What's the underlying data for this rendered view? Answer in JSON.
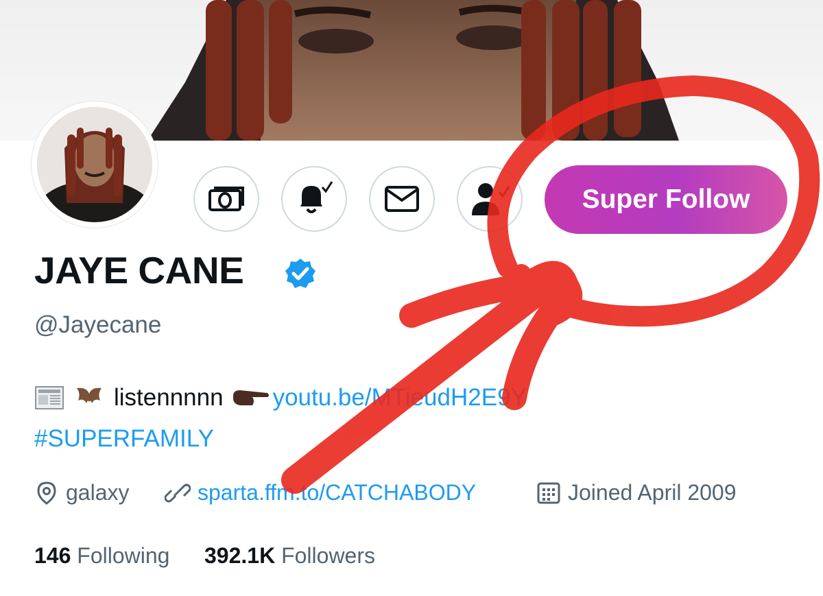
{
  "profile": {
    "name": "JAYE CANE",
    "handle": "@Jayecane",
    "bio_text": "listennnnn",
    "bio_link": "youtu.be/MTieudH2E9Y",
    "hashtag": "#SUPERFAMILY",
    "location": "galaxy",
    "website": "sparta.ffm.to/CATCHABODY",
    "joined": "Joined April 2009",
    "following_count": "146",
    "following_label": "Following",
    "followers_count": "392.1K",
    "followers_label": "Followers"
  },
  "actions": {
    "super_follow_label": "Super Follow",
    "icons": [
      "money-icon",
      "bell-icon",
      "mail-icon",
      "person-icon"
    ]
  },
  "colors": {
    "link": "#1d9bf0",
    "verified": "#1d9bf0",
    "super_follow_gradient": [
      "#c339b3",
      "#d655a8"
    ],
    "annotation": "#e8281e"
  }
}
